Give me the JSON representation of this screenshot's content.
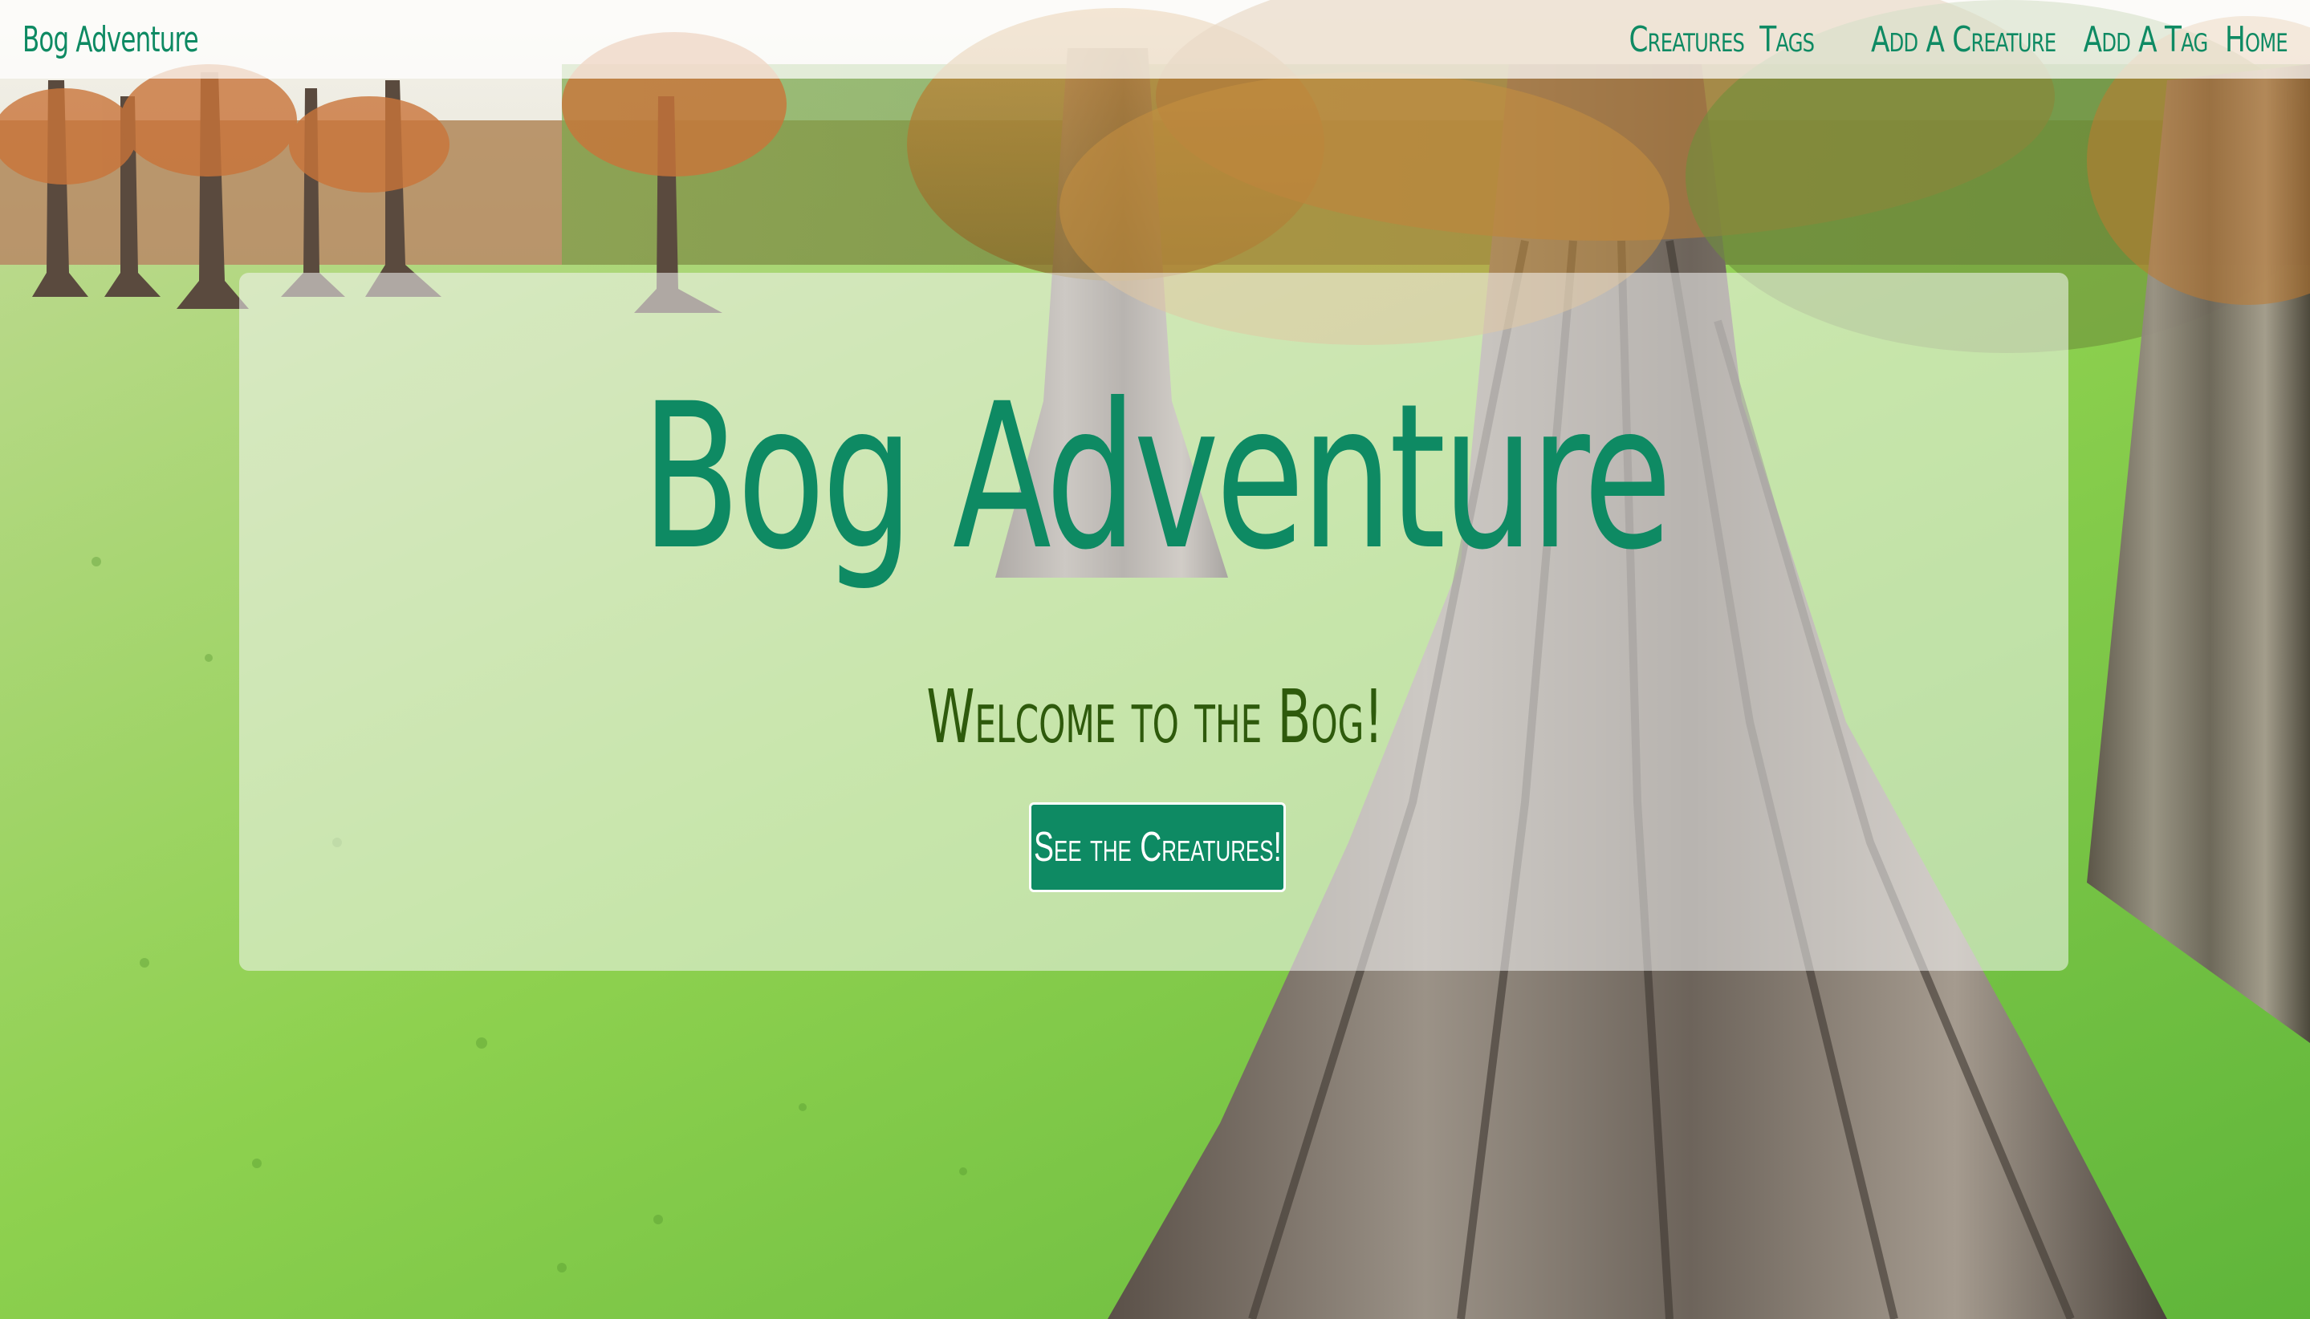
{
  "navbar": {
    "brand": "Bog Adventure",
    "links": [
      {
        "label": "Creatures"
      },
      {
        "label": "Tags"
      },
      {
        "label": "Add A Creature"
      },
      {
        "label": "Add A Tag"
      },
      {
        "label": "Home"
      }
    ]
  },
  "hero": {
    "title": "Bog Adventure",
    "subtitle": "Welcome to the Bog!",
    "cta_label": "See the Creatures!"
  },
  "colors": {
    "accent": "#0e8a63",
    "subtitle": "#2e5a0c",
    "button_text": "#ffffff"
  },
  "background": {
    "icon": "bog-cypress-photo"
  }
}
